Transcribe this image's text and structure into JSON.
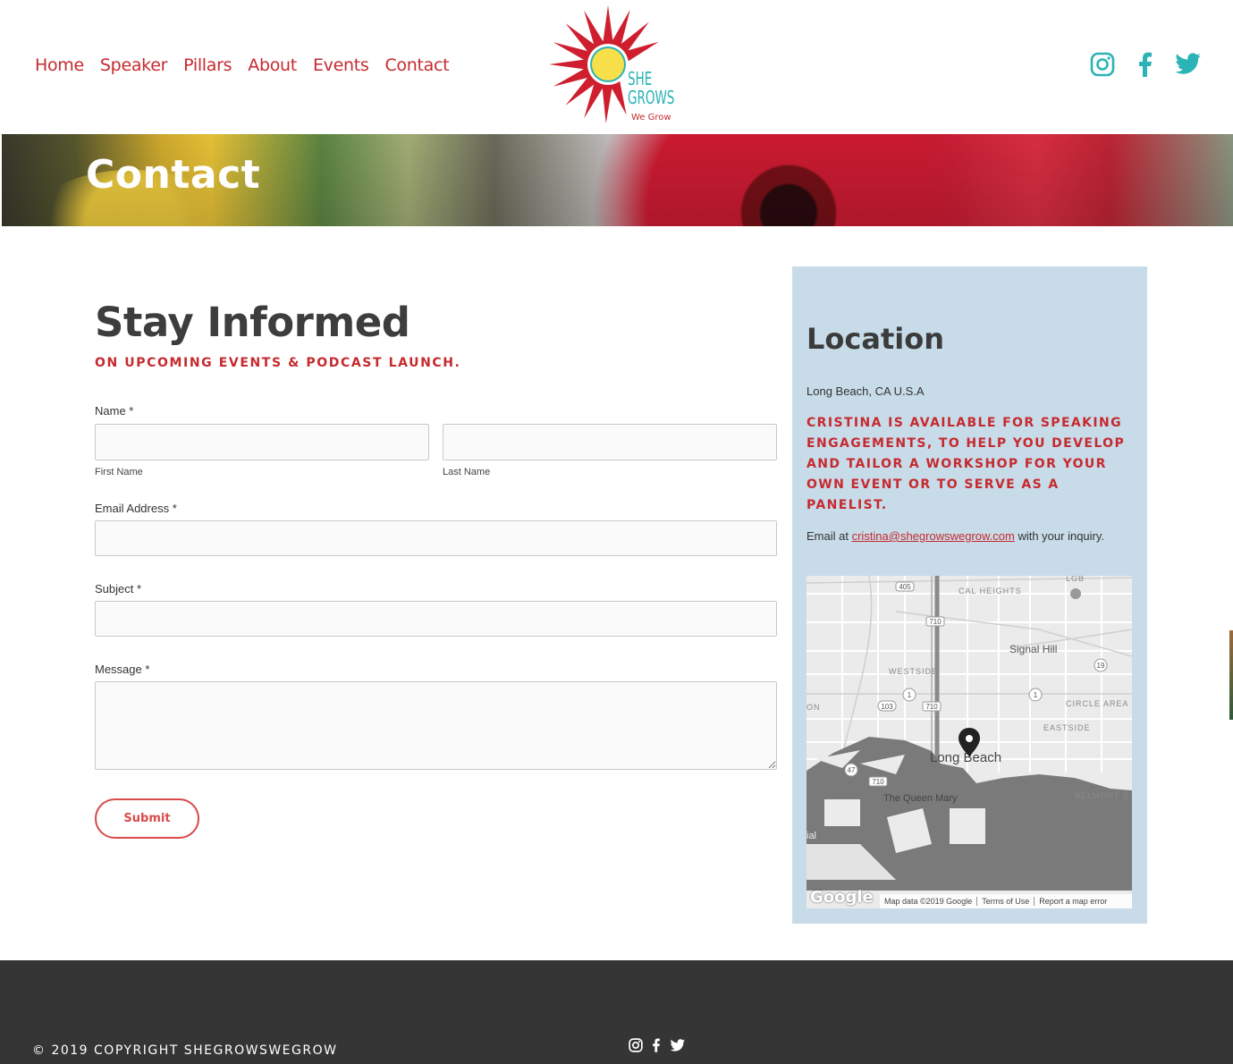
{
  "nav": {
    "items": [
      "Home",
      "Speaker",
      "Pillars",
      "About",
      "Events",
      "Contact"
    ]
  },
  "logo": {
    "line1": "SHE",
    "line2": "GROWS",
    "tagline": "We Grow"
  },
  "social": {
    "icons": [
      "instagram-icon",
      "facebook-icon",
      "twitter-icon"
    ],
    "color_top": "#2bb3b7",
    "color_footer": "#ffffff"
  },
  "banner": {
    "title": "Contact"
  },
  "form": {
    "title": "Stay Informed",
    "subtitle": "ON UPCOMING EVENTS & PODCAST LAUNCH.",
    "name_label": "Name *",
    "first_name_label": "First Name",
    "last_name_label": "Last Name",
    "email_label": "Email Address *",
    "subject_label": "Subject *",
    "message_label": "Message *",
    "submit_label": "Submit"
  },
  "location": {
    "title": "Location",
    "address": "Long Beach, CA U.S.A",
    "availability": "Cristina is available for speaking engagements, to help you develop and tailor a workshop for your own event or to serve as a panelist.",
    "email_prefix": "Email at ",
    "email": "cristina@shegrowswegrow.com",
    "email_suffix": " with your inquiry.",
    "map": {
      "labels": {
        "lgb": "LGB",
        "cal_heights": "CAL HEIGHTS",
        "signal_hill": "Signal Hill",
        "westside": "WESTSIDE",
        "circle_area": "CIRCLE AREA",
        "eastside": "EASTSIDE",
        "long_beach": "Long Beach",
        "queen_mary": "The Queen Mary",
        "belmont": "BELMONT S",
        "on": "ON",
        "ial": "ial"
      },
      "shields": [
        "405",
        "710",
        "19",
        "1",
        "103",
        "710",
        "1",
        "47",
        "710"
      ],
      "google": "Google",
      "map_data": "Map data ©2019 Google",
      "terms": "Terms of Use",
      "report": "Report a map error"
    }
  },
  "footer": {
    "copyright": "© 2019 COPYRIGHT SHEGROWSWEGROW"
  },
  "colors": {
    "brand_red": "#c62a2f",
    "teal": "#2bb3b7",
    "card_bg": "#c8dbe8",
    "footer_bg": "#353535"
  }
}
